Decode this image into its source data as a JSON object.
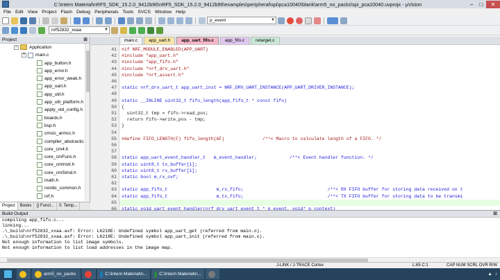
{
  "window": {
    "title": "C:\\Intern Material\\nRF5_SDK_15.2.0_9412b96\\nRF5_SDK_15.2.0_9412b96\\examples\\peripheral\\spi\\pca10040\\blank\\arm5_no_packs\\spi_pca10040.uvprojx - µVision",
    "min": "–",
    "max": "□",
    "close": "✕"
  },
  "menu": [
    "File",
    "Edit",
    "View",
    "Project",
    "Flash",
    "Debug",
    "Peripherals",
    "Tools",
    "SVCS",
    "Window",
    "Help"
  ],
  "toolbar": {
    "find_value": "p_event",
    "target": "nrf52832_xxaa"
  },
  "project_panel": {
    "title": "Project",
    "pin": "⊠",
    "tree": [
      {
        "label": "Application",
        "kind": "folder",
        "indent": 2,
        "expand": "−"
      },
      {
        "label": "main.c",
        "kind": "c",
        "indent": 3,
        "expand": "+"
      },
      {
        "label": "app_button.h",
        "kind": "h",
        "indent": 4
      },
      {
        "label": "app_error.h",
        "kind": "h",
        "indent": 4
      },
      {
        "label": "app_error_weak.h",
        "kind": "h",
        "indent": 4
      },
      {
        "label": "app_uart.h",
        "kind": "h",
        "indent": 4
      },
      {
        "label": "app_util.h",
        "kind": "h",
        "indent": 4
      },
      {
        "label": "app_util_platform.h",
        "kind": "h",
        "indent": 4
      },
      {
        "label": "apply_old_config.h",
        "kind": "h",
        "indent": 4
      },
      {
        "label": "boards.h",
        "kind": "h",
        "indent": 4
      },
      {
        "label": "bsp.h",
        "kind": "h",
        "indent": 4
      },
      {
        "label": "cmsis_armcc.h",
        "kind": "h",
        "indent": 4
      },
      {
        "label": "compiler_abstractic",
        "kind": "h",
        "indent": 4
      },
      {
        "label": "core_cm4.h",
        "kind": "h",
        "indent": 4
      },
      {
        "label": "core_cmFunc.h",
        "kind": "h",
        "indent": 4
      },
      {
        "label": "core_cmInstr.h",
        "kind": "h",
        "indent": 4
      },
      {
        "label": "core_cmSimd.h",
        "kind": "h",
        "indent": 4
      },
      {
        "label": "math.h",
        "kind": "h",
        "indent": 4
      },
      {
        "label": "nordic_common.h",
        "kind": "h",
        "indent": 4
      },
      {
        "label": "nrf.h",
        "kind": "h",
        "indent": 4
      }
    ],
    "tabs": [
      "Project",
      "Books",
      "{} Funct...",
      "0. Temp..."
    ]
  },
  "editor": {
    "tabs": [
      {
        "label": "main.c",
        "color": "#f3f3f3"
      },
      {
        "label": "app_uart.h",
        "color": "#f7e6a8"
      },
      {
        "label": "app_uart_fifo.c",
        "color": "#f5b8c8",
        "active": true
      },
      {
        "label": "app_fifo.c",
        "color": "#e1c7f0"
      },
      {
        "label": "retarget.c",
        "color": "#c9e8d6"
      }
    ],
    "lines": [
      {
        "n": "41",
        "t": "#if NRF_MODULE_ENABLED(APP_UART)",
        "c": "pp"
      },
      {
        "n": "42",
        "t": "#include \"app_uart.h\"",
        "c": "pp"
      },
      {
        "n": "43",
        "t": "#include \"app_fifo.h\"",
        "c": "pp"
      },
      {
        "n": "44",
        "t": "#include \"nrf_drv_uart.h\"",
        "c": "pp"
      },
      {
        "n": "45",
        "t": "#include \"nrf_assert.h\"",
        "c": "pp"
      },
      {
        "n": "46",
        "t": "",
        "c": ""
      },
      {
        "n": "47",
        "t": "static nrf_drv_uart_t app_uart_inst = NRF_DRV_UART_INSTANCE(APP_UART_DRIVER_INSTANCE);",
        "c": "kw"
      },
      {
        "n": "48",
        "t": "",
        "c": ""
      },
      {
        "n": "49",
        "t": "static __INLINE uint32_t fifo_length(app_fifo_t * const fifo)",
        "c": "kw"
      },
      {
        "n": "50",
        "t": "{",
        "c": ""
      },
      {
        "n": "51",
        "t": "  uint32_t tmp = fifo->read_pos;",
        "c": ""
      },
      {
        "n": "52",
        "t": "  return fifo->write_pos - tmp;",
        "c": ""
      },
      {
        "n": "53",
        "t": "}",
        "c": ""
      },
      {
        "n": "54",
        "t": "",
        "c": ""
      },
      {
        "n": "55",
        "t": "#define FIFO_LENGTH(F) fifo_length(&F)              /**< Macro to calculate length of a FIFO. */",
        "c": "pp"
      },
      {
        "n": "56",
        "t": "",
        "c": ""
      },
      {
        "n": "57",
        "t": "",
        "c": ""
      },
      {
        "n": "58",
        "t": "static app_uart_event_handler_t   m_event_handler;            /**< Event handler function. */",
        "c": "kw"
      },
      {
        "n": "59",
        "t": "static uint8_t tx_buffer[1];",
        "c": "kw"
      },
      {
        "n": "60",
        "t": "static uint8_t rx_buffer[1];",
        "c": "kw"
      },
      {
        "n": "61",
        "t": "static bool m_rx_ovf;",
        "c": "kw"
      },
      {
        "n": "62",
        "t": "",
        "c": ""
      },
      {
        "n": "63",
        "t": "static app_fifo_t                  m_rx_fifo;                               /**< RX FIFO buffer for storing data received on t",
        "c": "kw"
      },
      {
        "n": "64",
        "t": "static app_fifo_t                  m_tx_fifo;                               /**< TX FIFO buffer for storing data to be transmi",
        "c": "kw"
      },
      {
        "n": "65",
        "t": "",
        "c": "",
        "hl": true
      },
      {
        "n": "66",
        "t": "static void uart_event_handler(nrf_drv_uart_event_t * p_event, void* p_context)",
        "c": "kw"
      }
    ]
  },
  "build": {
    "title": "Build Output",
    "pin": "⊠",
    "lines": [
      "compiling app_fifo.c...",
      "linking...",
      ".\\_build\\nrf52832_xxaa.axf: Error: L6218E: Undefined symbol app_uart_get (referred from main.o).",
      ".\\_build\\nrf52832_xxaa.axf: Error: L6218E: Undefined symbol app_uart_init (referred from main.o).",
      "Not enough information to list image symbols.",
      "Not enough information to list load addresses in the image map."
    ]
  },
  "status": {
    "debugger": "J-LINK / J-TRACE Cortex",
    "position": "L:65 C:1",
    "keys": "CAP  NUM  SCRL  OVR  R/W"
  },
  "taskbar": {
    "items": [
      {
        "label": "",
        "color": "#f4c21f"
      },
      {
        "label": "arm5_no_packs",
        "color": "#f4c21f"
      },
      {
        "label": "",
        "color": "#e94235"
      },
      {
        "label": "C:\\Intern Material\\n...",
        "color": "#1c7ab8"
      },
      {
        "label": "C:\\Intern Material\\n...",
        "color": "#2b8b3a"
      },
      {
        "label": "",
        "color": "#7a7a7a"
      }
    ]
  }
}
